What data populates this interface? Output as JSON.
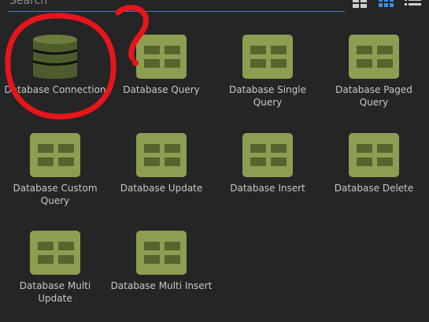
{
  "search": {
    "placeholder": "Search",
    "value": ""
  },
  "view_modes": [
    {
      "name": "large-grid-view",
      "icon": "large-grid-icon",
      "selected": false
    },
    {
      "name": "small-grid-view",
      "icon": "small-grid-icon",
      "selected": true
    },
    {
      "name": "list-view",
      "icon": "list-icon",
      "selected": false
    }
  ],
  "colors": {
    "background": "#252526",
    "icon_fill": "#8c9e52",
    "icon_cell": "#56652e",
    "db_icon_fill": "#4d5c2c",
    "selected_view": "#3a8ee6",
    "annotation": "#e8141c"
  },
  "components": [
    {
      "label": "Database Connection",
      "icon": "database-icon"
    },
    {
      "label": "Database Query",
      "icon": "table-icon"
    },
    {
      "label": "Database Single Query",
      "icon": "table-icon"
    },
    {
      "label": "Database Paged Query",
      "icon": "table-icon"
    },
    {
      "label": "Database Custom Query",
      "icon": "table-icon"
    },
    {
      "label": "Database Update",
      "icon": "table-icon"
    },
    {
      "label": "Database Insert",
      "icon": "table-icon"
    },
    {
      "label": "Database Delete",
      "icon": "table-icon"
    },
    {
      "label": "Database Multi Update",
      "icon": "table-icon"
    },
    {
      "label": "Database Multi Insert",
      "icon": "table-icon"
    }
  ]
}
